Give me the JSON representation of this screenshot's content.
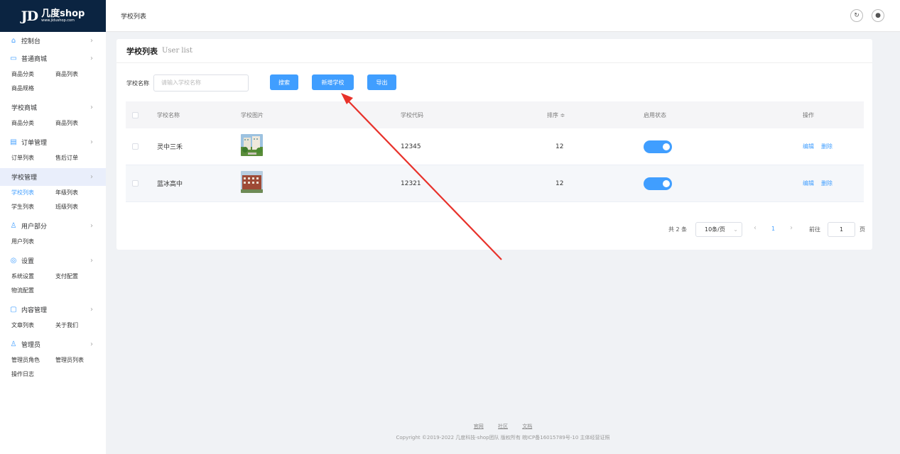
{
  "logo": {
    "mark": "JD",
    "brand": "几度shop",
    "url": "www.jidushop.com"
  },
  "header": {
    "breadcrumb": "学校列表",
    "refresh_icon": "↻",
    "user_icon": "●"
  },
  "sidebar": {
    "sections": [
      {
        "label": "控制台",
        "icon": "home-icon",
        "glyph": "⌂",
        "subs": []
      },
      {
        "label": "普通商城",
        "icon": "shop-icon",
        "glyph": "▭",
        "subs": [
          "商品分类",
          "商品列表",
          "商品规格"
        ]
      },
      {
        "label": "学校商城",
        "icon": "",
        "glyph": "",
        "subs": [
          "商品分类",
          "商品列表"
        ]
      },
      {
        "label": "订单管理",
        "icon": "order-icon",
        "glyph": "▤",
        "subs": [
          "订单列表",
          "售后订单"
        ]
      },
      {
        "label": "学校管理",
        "icon": "",
        "glyph": "",
        "subs": [
          "学校列表",
          "年级列表",
          "学生列表",
          "班级列表"
        ]
      },
      {
        "label": "用户部分",
        "icon": "user-icon",
        "glyph": "♙",
        "subs": [
          "用户列表"
        ]
      },
      {
        "label": "设置",
        "icon": "settings-icon",
        "glyph": "◎",
        "subs": [
          "系统设置",
          "支付配置",
          "物流配置"
        ]
      },
      {
        "label": "内容管理",
        "icon": "document-icon",
        "glyph": "▢",
        "subs": [
          "文章列表",
          "关于我们"
        ]
      },
      {
        "label": "管理员",
        "icon": "admin-icon",
        "glyph": "♙",
        "subs": [
          "管理员角色",
          "管理员列表",
          "操作日志"
        ]
      }
    ],
    "chevron": "›"
  },
  "card": {
    "title": "学校列表",
    "subtitle": "User list"
  },
  "search": {
    "label": "学校名称",
    "placeholder": "请输入学校名称",
    "search_btn": "搜索",
    "add_btn": "新增学校",
    "export_btn": "导出"
  },
  "table": {
    "headers": {
      "name": "学校名称",
      "image": "学校图片",
      "code": "学校代码",
      "sort": "排序 ≑",
      "status": "启用状态",
      "actions": "操作"
    },
    "rows": [
      {
        "name": "灵中三禾",
        "code": "12345",
        "sort": "12",
        "enabled": true,
        "edit": "编辑",
        "delete": "删除"
      },
      {
        "name": "蓝冰高中",
        "code": "12321",
        "sort": "12",
        "enabled": true,
        "edit": "编辑",
        "delete": "删除"
      }
    ]
  },
  "pagination": {
    "total": "共 2 条",
    "page_size": "10条/页",
    "prev": "‹",
    "current": "1",
    "next": "›",
    "goto_label": "前往",
    "goto_value": "1",
    "page_suffix": "页",
    "dropdown": "⌄"
  },
  "footer": {
    "links": [
      "官网",
      "社区",
      "文档"
    ],
    "copyright": "Copyright ©2019-2022 几度科技-shop团队 版权所有 皖ICP备16015789号-10 主体经营证照"
  },
  "colors": {
    "accent": "#409eff",
    "logo_bg": "#0b2441",
    "arrow": "#e8322b"
  }
}
